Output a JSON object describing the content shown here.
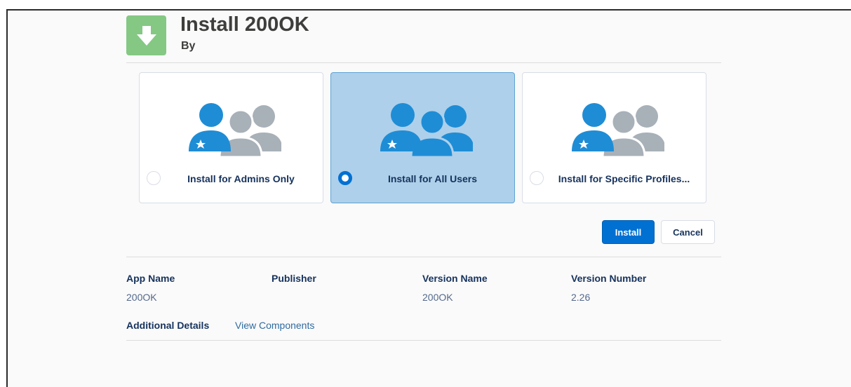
{
  "header": {
    "title": "Install 200OK",
    "by_label": "By"
  },
  "icons": {
    "app_icon": "download-arrow-icon",
    "admins": "people-admin-icon",
    "all_users": "people-all-icon",
    "specific": "people-specific-icon"
  },
  "colors": {
    "accent": "#0070d2",
    "selected_bg": "#aed0ea",
    "people_blue": "#1e8dd6",
    "people_gray": "#a8b0b8",
    "app_icon_bg": "#84c884"
  },
  "install_options": [
    {
      "label": "Install for Admins Only",
      "selected": false
    },
    {
      "label": "Install for All Users",
      "selected": true
    },
    {
      "label": "Install for Specific Profiles...",
      "selected": false
    }
  ],
  "buttons": {
    "install": "Install",
    "cancel": "Cancel"
  },
  "package_info": {
    "headers": [
      "App Name",
      "Publisher",
      "Version Name",
      "Version Number"
    ],
    "values": [
      "200OK",
      "",
      "200OK",
      "2.26"
    ]
  },
  "details": {
    "label": "Additional Details",
    "link": "View Components"
  }
}
